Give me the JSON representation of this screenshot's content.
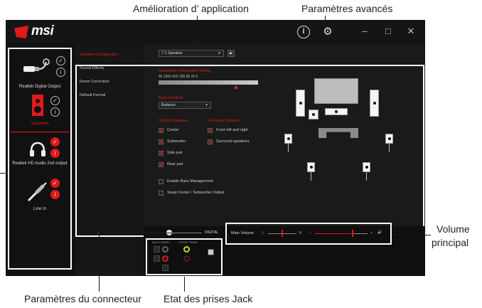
{
  "callouts": {
    "app_enhancement": "Amélioration d’ application",
    "advanced_settings": "Paramètres avancés",
    "main_volume_line1": "Volume",
    "main_volume_line2": "principal",
    "connector_settings": "Paramètres du connecteur",
    "jack_status": "Etat des prises Jack"
  },
  "app": {
    "logo": "msi",
    "info_glyph": "i",
    "gear_glyph": "⚙",
    "min_glyph": "–",
    "max_glyph": "□",
    "close_glyph": "✕"
  },
  "devices": [
    {
      "label": "Realtek Digital Output",
      "icon": "digital-output-icon",
      "badges": [
        "check-white",
        "info-white"
      ]
    },
    {
      "label": "Speakers",
      "icon": "speaker-icon",
      "badges": [
        "check-white",
        "info-white"
      ]
    },
    {
      "label": "Realtek HD Audio 2nd output",
      "icon": "headphones-icon",
      "badges": [
        "check-red",
        "info-red"
      ]
    },
    {
      "label": "Line In",
      "icon": "line-in-cable-icon",
      "badges": [
        "check-red",
        "info-red"
      ]
    }
  ],
  "menu": [
    {
      "label": "Speaker Configuration",
      "active": true
    },
    {
      "label": "Sound Effects",
      "active": false
    },
    {
      "label": "Room Correction",
      "active": false
    },
    {
      "label": "Default Format",
      "active": false
    }
  ],
  "config": {
    "speaker_select": "7.1 Speaker",
    "play_glyph": "▶",
    "eq_title": "Headphone Virtualization Setting",
    "eq_freqs": "4k    1000    420    180    80    32    0",
    "balance_title": "Balanced Mode",
    "balance_value": "Balance",
    "optional_title": "Optional Speakers",
    "fullrange_title": "Full-range Speakers",
    "optional": [
      {
        "label": "Center",
        "checked": true
      },
      {
        "label": "Subwoofer",
        "checked": true
      },
      {
        "label": "Side pair",
        "checked": true
      },
      {
        "label": "Rear pair",
        "checked": true
      }
    ],
    "fullrange": [
      {
        "label": "Front left and right",
        "checked": true
      },
      {
        "label": "Surround speakers",
        "checked": true
      }
    ],
    "extras": [
      {
        "label": "Enable Bass Management",
        "checked": false
      },
      {
        "label": "Swap Center / Subwoofer Output",
        "checked": false
      }
    ]
  },
  "bottom": {
    "digital_label": "DIGITAL",
    "back_panel": "BACK PANEL",
    "front_panel": "FRONT PANEL",
    "main_volume": "Main Volume",
    "vol_L": "L",
    "vol_R": "R",
    "vol_minus": "−",
    "vol_plus": "+",
    "speaker_glyph": "🔊",
    "balance_position": 0.5,
    "volume_level": 0.72
  },
  "colors": {
    "accent": "#e01a1a",
    "bg": "#0c0c0c"
  }
}
